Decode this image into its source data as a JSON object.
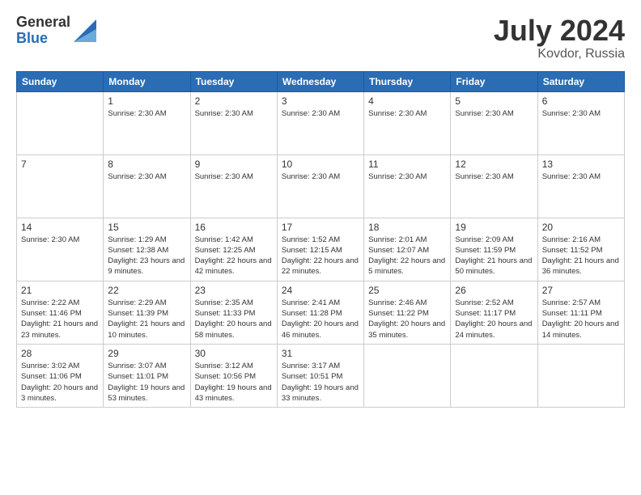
{
  "header": {
    "logo": {
      "general": "General",
      "blue": "Blue"
    },
    "title": "July 2024",
    "location": "Kovdor, Russia"
  },
  "calendar": {
    "days_of_week": [
      "Sunday",
      "Monday",
      "Tuesday",
      "Wednesday",
      "Thursday",
      "Friday",
      "Saturday"
    ],
    "weeks": [
      [
        {
          "day": "",
          "info": ""
        },
        {
          "day": "1",
          "info": "Sunrise: 2:30 AM"
        },
        {
          "day": "2",
          "info": "Sunrise: 2:30 AM"
        },
        {
          "day": "3",
          "info": "Sunrise: 2:30 AM"
        },
        {
          "day": "4",
          "info": "Sunrise: 2:30 AM"
        },
        {
          "day": "5",
          "info": "Sunrise: 2:30 AM"
        },
        {
          "day": "6",
          "info": "Sunrise: 2:30 AM"
        }
      ],
      [
        {
          "day": "7",
          "info": ""
        },
        {
          "day": "8",
          "info": "Sunrise: 2:30 AM"
        },
        {
          "day": "9",
          "info": "Sunrise: 2:30 AM"
        },
        {
          "day": "10",
          "info": "Sunrise: 2:30 AM"
        },
        {
          "day": "11",
          "info": "Sunrise: 2:30 AM"
        },
        {
          "day": "12",
          "info": "Sunrise: 2:30 AM"
        },
        {
          "day": "13",
          "info": "Sunrise: 2:30 AM"
        }
      ],
      [
        {
          "day": "14",
          "info": "Sunrise: 2:30 AM"
        },
        {
          "day": "15",
          "info": "Sunrise: 1:29 AM\nSunset: 12:38 AM\nDaylight: 23 hours and 9 minutes."
        },
        {
          "day": "16",
          "info": "Sunrise: 1:42 AM\nSunset: 12:25 AM\nDaylight: 22 hours and 42 minutes."
        },
        {
          "day": "17",
          "info": "Sunrise: 1:52 AM\nSunset: 12:15 AM\nDaylight: 22 hours and 22 minutes."
        },
        {
          "day": "18",
          "info": "Sunrise: 2:01 AM\nSunset: 12:07 AM\nDaylight: 22 hours and 5 minutes."
        },
        {
          "day": "19",
          "info": "Sunrise: 2:09 AM\nSunset: 11:59 PM\nDaylight: 21 hours and 50 minutes."
        },
        {
          "day": "20",
          "info": "Sunrise: 2:16 AM\nSunset: 11:52 PM\nDaylight: 21 hours and 36 minutes."
        }
      ],
      [
        {
          "day": "21",
          "info": "Sunrise: 2:22 AM\nSunset: 11:46 PM\nDaylight: 21 hours and 23 minutes."
        },
        {
          "day": "22",
          "info": "Sunrise: 2:29 AM\nSunset: 11:39 PM\nDaylight: 21 hours and 10 minutes."
        },
        {
          "day": "23",
          "info": "Sunrise: 2:35 AM\nSunset: 11:33 PM\nDaylight: 20 hours and 58 minutes."
        },
        {
          "day": "24",
          "info": "Sunrise: 2:41 AM\nSunset: 11:28 PM\nDaylight: 20 hours and 46 minutes."
        },
        {
          "day": "25",
          "info": "Sunrise: 2:46 AM\nSunset: 11:22 PM\nDaylight: 20 hours and 35 minutes."
        },
        {
          "day": "26",
          "info": "Sunrise: 2:52 AM\nSunset: 11:17 PM\nDaylight: 20 hours and 24 minutes."
        },
        {
          "day": "27",
          "info": "Sunrise: 2:57 AM\nSunset: 11:11 PM\nDaylight: 20 hours and 14 minutes."
        }
      ],
      [
        {
          "day": "28",
          "info": "Sunrise: 3:02 AM\nSunset: 11:06 PM\nDaylight: 20 hours and 3 minutes."
        },
        {
          "day": "29",
          "info": "Sunrise: 3:07 AM\nSunset: 11:01 PM\nDaylight: 19 hours and 53 minutes."
        },
        {
          "day": "30",
          "info": "Sunrise: 3:12 AM\nSunset: 10:56 PM\nDaylight: 19 hours and 43 minutes."
        },
        {
          "day": "31",
          "info": "Sunrise: 3:17 AM\nSunset: 10:51 PM\nDaylight: 19 hours and 33 minutes."
        },
        {
          "day": "",
          "info": ""
        },
        {
          "day": "",
          "info": ""
        },
        {
          "day": "",
          "info": ""
        }
      ]
    ]
  }
}
